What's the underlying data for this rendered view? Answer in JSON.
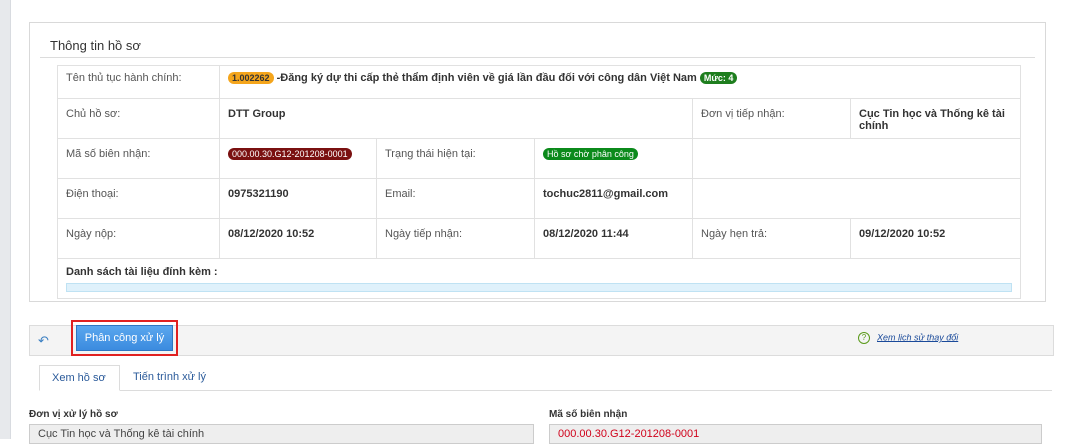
{
  "panel": {
    "title": "Thông tin hồ sơ",
    "procedure_label": "Tên thủ tục hành chính:",
    "procedure_code": "1.002262",
    "procedure_name": "-Đăng ký dự thi cấp thẻ thẩm định viên về giá lần đầu đối với công dân Việt Nam",
    "level_badge": "Mức: 4",
    "owner_label": "Chủ hồ sơ:",
    "owner_value": "DTT Group",
    "receiving_unit_label": "Đơn vị tiếp nhận:",
    "receiving_unit_value": "Cục Tin học và Thống kê tài chính",
    "receipt_no_label": "Mã số biên nhận:",
    "receipt_no_value": "000.00.30.G12-201208-0001",
    "status_label": "Trạng thái hiện tại:",
    "status_value": "Hồ sơ chờ phân công",
    "phone_label": "Điện thoại:",
    "phone_value": "0975321190",
    "email_label": "Email:",
    "email_value": "tochuc2811@gmail.com",
    "submit_date_label": "Ngày nộp:",
    "submit_date_value": "08/12/2020 10:52",
    "received_date_label": "Ngày tiếp nhận:",
    "received_date_value": "08/12/2020 11:44",
    "due_date_label": "Ngày hẹn trả:",
    "due_date_value": "09/12/2020 10:52",
    "attachments_label": "Danh sách tài liệu đính kèm :"
  },
  "toolbar": {
    "assign_label": "Phân công xử lý",
    "history_label": "Xem lịch sử thay đổi"
  },
  "tabs": [
    {
      "label": "Xem hồ sơ"
    },
    {
      "label": "Tiến trình xử lý"
    }
  ],
  "form": {
    "unit_label": "Đơn vị xử lý hồ sơ",
    "unit_value": "Cục Tin học và Thống kê tài chính",
    "receipt_label": "Mã số biên nhận",
    "receipt_value": "000.00.30.G12-201208-0001"
  },
  "colors": {
    "receipt_value": "#d0021b",
    "assign_highlight": "#e02020",
    "button_blue": "#3b8bdf"
  },
  "icons": {
    "refresh": "refresh-icon",
    "history": "history-icon"
  }
}
